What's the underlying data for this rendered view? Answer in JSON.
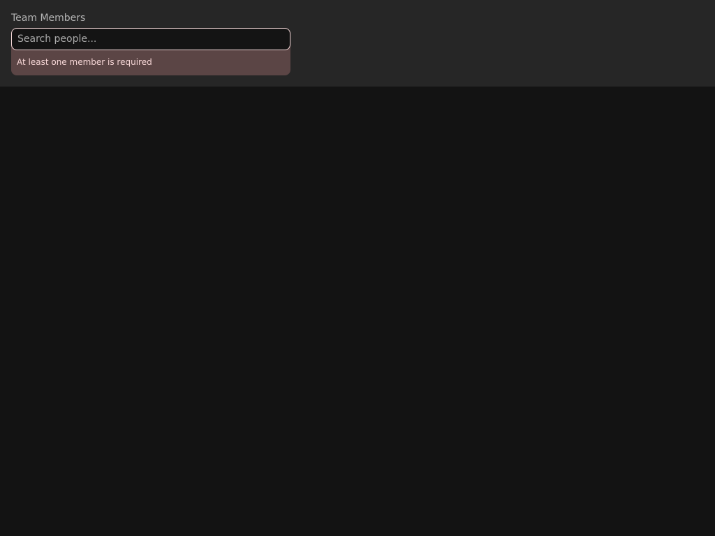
{
  "team_members": {
    "label": "Team Members",
    "search": {
      "value": "",
      "placeholder": "Search people..."
    },
    "error": "At least one member is required"
  },
  "colors": {
    "panel_bg": "#262626",
    "page_bg": "#131313",
    "error_bg": "#5b4545",
    "error_text": "#f6d6d6",
    "input_border": "#f2d6d6"
  }
}
